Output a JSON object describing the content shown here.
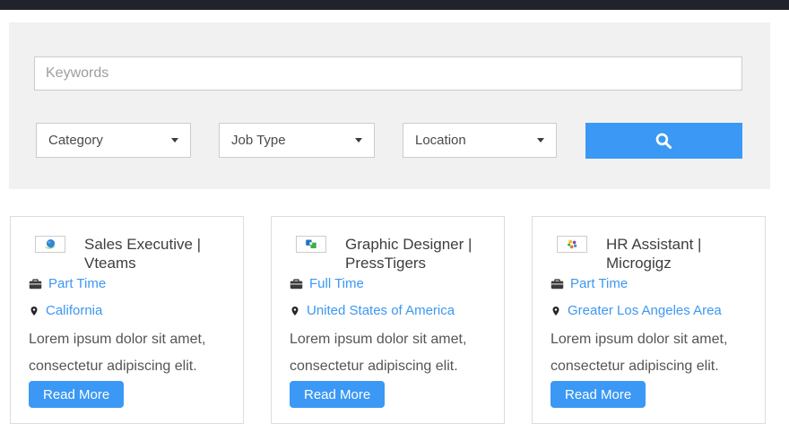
{
  "colors": {
    "topbar_bg": "#20242a",
    "panel_bg": "#f1f1f1",
    "accent_blue": "#3b98f4",
    "link_blue": "#3d97f2"
  },
  "search_panel": {
    "keywords_placeholder": "Keywords",
    "category_label": "Category",
    "job_type_label": "Job Type",
    "location_label": "Location",
    "search_icon": "search-icon",
    "dropdown_icon": "chevron-down-icon"
  },
  "icons": {
    "job_type": "briefcase-icon",
    "location": "map-pin-icon"
  },
  "jobs": [
    {
      "title": "Sales Executive | Vteams",
      "logo": "vteams-logo",
      "type": "Part Time",
      "location": "California",
      "description": "Lorem ipsum dolor sit amet, consectetur adipiscing elit.",
      "read_more": "Read More"
    },
    {
      "title": "Graphic Designer | PressTigers",
      "logo": "presstigers-logo",
      "type": "Full Time",
      "location": "United States of America",
      "description": "Lorem ipsum dolor sit amet, consectetur adipiscing elit.",
      "read_more": "Read More"
    },
    {
      "title": "HR Assistant | Microgigz",
      "logo": "microgigz-logo",
      "type": "Part Time",
      "location": "Greater Los Angeles Area",
      "description": "Lorem ipsum dolor sit amet, consectetur adipiscing elit.",
      "read_more": "Read More"
    }
  ]
}
